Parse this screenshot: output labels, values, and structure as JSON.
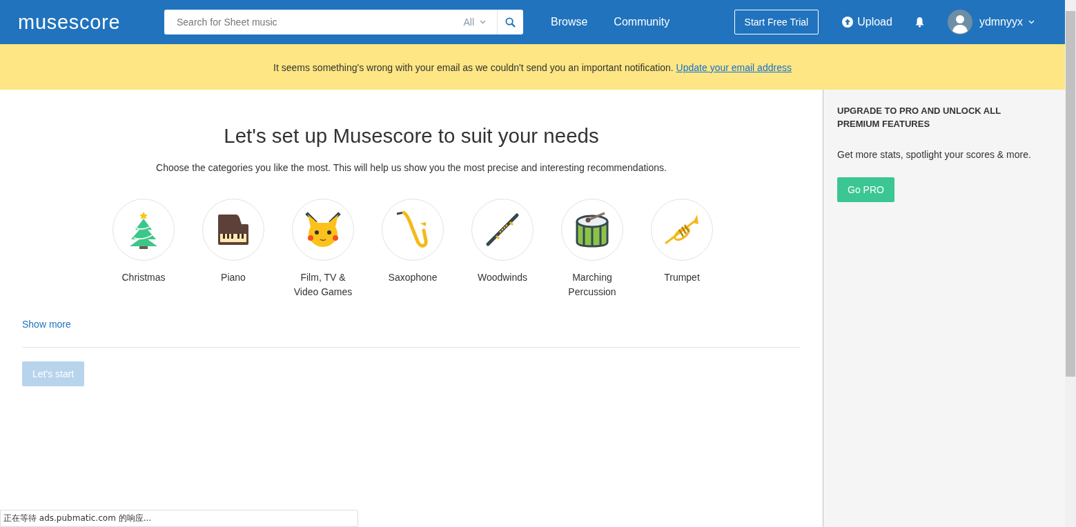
{
  "header": {
    "logo": "musescore",
    "search": {
      "placeholder": "Search for Sheet music",
      "filter": "All"
    },
    "nav": [
      "Browse",
      "Community"
    ],
    "trial_button": "Start Free Trial",
    "upload": "Upload",
    "username": "ydmnyyx"
  },
  "banner": {
    "message": "It seems something's wrong with your email as we couldn't send you an important notification.",
    "link": "Update your email address"
  },
  "main": {
    "title": "Let's set up Musescore to suit your needs",
    "subtitle": "Choose the categories you like the most. This will help us show you the most precise and interesting recommendations.",
    "categories": [
      {
        "label": "Christmas",
        "selected": false
      },
      {
        "label": "Piano",
        "selected": false
      },
      {
        "label": "Film, TV & Video Games",
        "selected": false
      },
      {
        "label": "Saxophone",
        "selected": false
      },
      {
        "label": "Woodwinds",
        "selected": false
      },
      {
        "label": "Marching Percussion",
        "selected": false
      },
      {
        "label": "Trumpet",
        "selected": false
      }
    ],
    "show_more": "Show more",
    "start_button": {
      "label": "Let's start",
      "disabled": true
    }
  },
  "sidebar": {
    "title": "UPGRADE TO PRO AND UNLOCK ALL PREMIUM FEATURES",
    "text": "Get more stats, spotlight your scores & more.",
    "button": "Go PRO"
  },
  "status_bar": "正在等待 ads.pubmatic.com 的响应..."
}
